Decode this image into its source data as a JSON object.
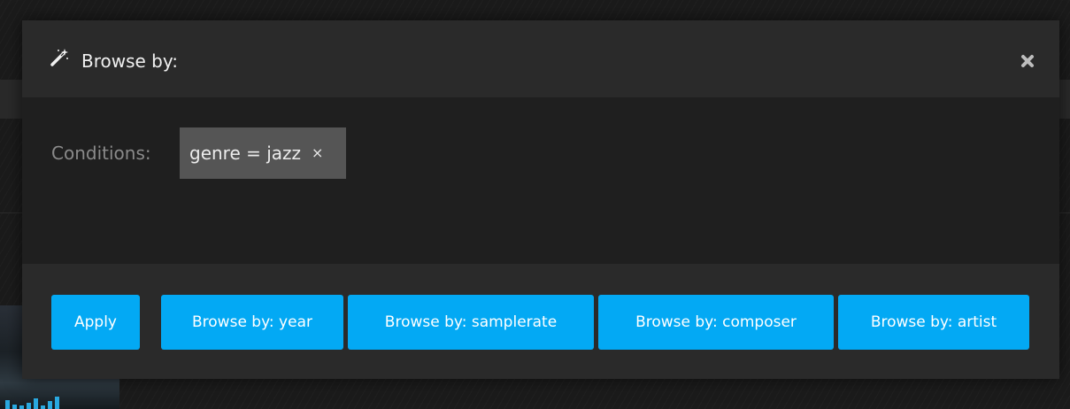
{
  "modal": {
    "title": "Browse by:",
    "title_icon": "magic-wand-icon",
    "close_icon": "close-icon"
  },
  "conditions": {
    "label": "Conditions:",
    "chips": [
      {
        "text": "genre = jazz",
        "remove_symbol": "×"
      }
    ]
  },
  "footer": {
    "apply_label": "Apply",
    "browse_buttons": [
      "Browse by: year",
      "Browse by: samplerate",
      "Browse by: composer",
      "Browse by: artist"
    ]
  },
  "colors": {
    "accent": "#03a9f4",
    "header_bg": "#2a2a2a",
    "body_bg": "#1f1f1f",
    "chip_bg": "#555555"
  }
}
